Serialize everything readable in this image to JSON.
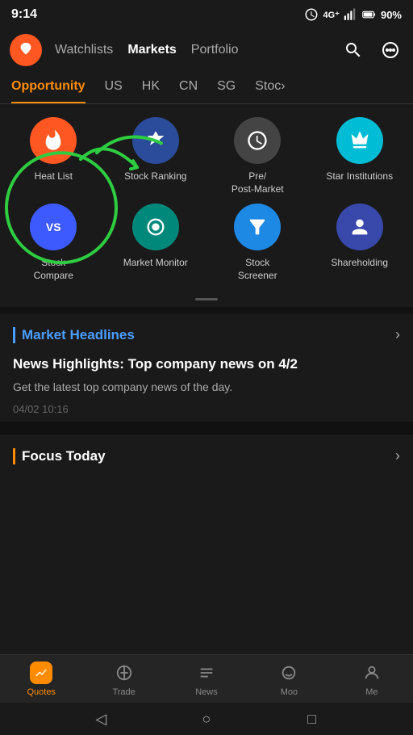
{
  "statusBar": {
    "time": "9:14",
    "battery": "90%"
  },
  "topNav": {
    "links": [
      {
        "label": "Watchlists",
        "active": false
      },
      {
        "label": "Markets",
        "active": true
      },
      {
        "label": "Portfolio",
        "active": false
      }
    ]
  },
  "tabs": [
    {
      "label": "Opportunity",
      "active": true
    },
    {
      "label": "US",
      "active": false
    },
    {
      "label": "HK",
      "active": false
    },
    {
      "label": "CN",
      "active": false
    },
    {
      "label": "SG",
      "active": false
    },
    {
      "label": "Stoc...",
      "active": false
    }
  ],
  "iconsGrid": {
    "row1": [
      {
        "label": "Heat List",
        "colorClass": "ic-orange"
      },
      {
        "label": "Stock Ranking",
        "colorClass": "ic-blue-dark"
      },
      {
        "label": "Pre/ Post-Market",
        "colorClass": "ic-gray-dark"
      },
      {
        "label": "Star Institutions",
        "colorClass": "ic-cyan"
      }
    ],
    "row2": [
      {
        "label": "Stock Compare",
        "colorClass": "ic-blue-vs"
      },
      {
        "label": "Market Monitor",
        "colorClass": "ic-teal"
      },
      {
        "label": "Stock Screener",
        "colorClass": "ic-blue-filter"
      },
      {
        "label": "Shareholding",
        "colorClass": "ic-blue-share"
      }
    ]
  },
  "marketHeadlines": {
    "sectionTitle": "Market Headlines",
    "headline": "News Highlights: Top company news on 4/2",
    "subtext": "Get the latest top company news of the day.",
    "timestamp": "04/02 10:16"
  },
  "focusToday": {
    "sectionTitle": "Focus Today"
  },
  "bottomNav": {
    "items": [
      {
        "label": "Quotes",
        "active": true
      },
      {
        "label": "Trade",
        "active": false
      },
      {
        "label": "News",
        "active": false
      },
      {
        "label": "Moo",
        "active": false
      },
      {
        "label": "Me",
        "active": false
      }
    ]
  }
}
